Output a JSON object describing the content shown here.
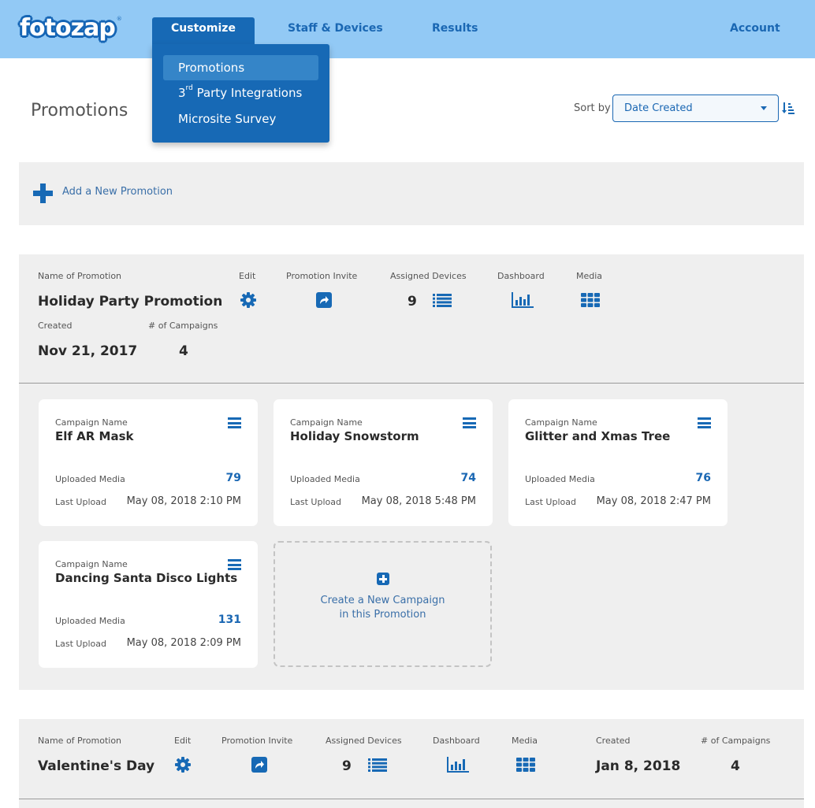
{
  "header": {
    "logo": "fotozap",
    "logo_mark": "®",
    "nav": [
      {
        "label": "Customize",
        "active": true
      },
      {
        "label": "Staff & Devices",
        "active": false
      },
      {
        "label": "Results",
        "active": false
      },
      {
        "label": "Account",
        "active": false
      }
    ],
    "dropdown": [
      {
        "label": "Promotions",
        "active": true
      },
      {
        "label_prefix": "3",
        "label_sup": "rd",
        "label": " Party Integrations",
        "active": false
      },
      {
        "label": "Microsite Survey",
        "active": false
      }
    ]
  },
  "page": {
    "title": "Promotions",
    "sort_label": "Sort by",
    "sort_value": "Date Created",
    "sort_order_icon": "sort-amount-down-icon",
    "add_label": "Add a New Promotion"
  },
  "labels": {
    "name": "Name of Promotion",
    "edit": "Edit",
    "invite": "Promotion Invite",
    "devices": "Assigned Devices",
    "dashboard": "Dashboard",
    "media": "Media",
    "created": "Created",
    "campaigns": "# of Campaigns",
    "campaign_name": "Campaign Name",
    "uploaded_media": "Uploaded Media",
    "last_upload": "Last Upload",
    "new_campaign_line1": "Create a New Campaign",
    "new_campaign_line2": "in this Promotion"
  },
  "promotions": [
    {
      "name": "Holiday Party Promotion",
      "assigned_devices": "9",
      "created": "Nov 21, 2017",
      "campaign_count": "4",
      "campaigns": [
        {
          "name": "Elf AR Mask",
          "uploaded_media": "79",
          "last_upload": "May 08, 2018 2:10 PM"
        },
        {
          "name": "Holiday Snowstorm",
          "uploaded_media": "74",
          "last_upload": "May 08, 2018 5:48 PM"
        },
        {
          "name": "Glitter and Xmas Tree",
          "uploaded_media": "76",
          "last_upload": "May 08, 2018 2:47 PM"
        },
        {
          "name": "Dancing Santa Disco Lights",
          "uploaded_media": "131",
          "last_upload": "May 08, 2018 2:09 PM"
        }
      ]
    },
    {
      "name": "Valentine's Day",
      "assigned_devices": "9",
      "created": "Jan 8, 2018",
      "campaign_count": "4"
    }
  ],
  "colors": {
    "header_bg": "#92c9f5",
    "primary": "#1769b5",
    "dropdown_active": "#3585c8",
    "panel_bg": "#efefef"
  }
}
